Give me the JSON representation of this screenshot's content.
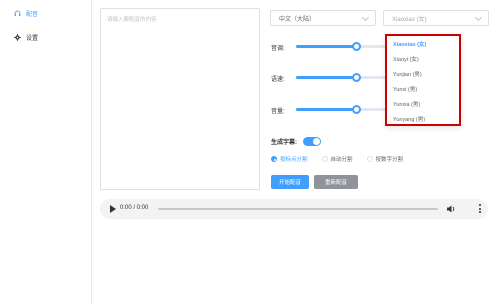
{
  "sidebar": {
    "items": [
      {
        "label": "配音",
        "icon": "headset-icon",
        "active": true
      },
      {
        "label": "设置",
        "icon": "gear-icon",
        "active": false
      }
    ]
  },
  "editor": {
    "placeholder": "请输入要配音的内容"
  },
  "language_select": {
    "value": "中文（大陆）"
  },
  "voice_select": {
    "value": "Xiaoxiao (女)"
  },
  "sliders": {
    "pitch": {
      "label": "音调:",
      "value": 0.5
    },
    "speed": {
      "label": "语速:",
      "value": 0.5
    },
    "volume": {
      "label": "音量:",
      "value": 0.5
    }
  },
  "subtitle": {
    "label": "生成字幕:",
    "enabled": true
  },
  "split_options": [
    {
      "label": "按标点分割",
      "checked": true
    },
    {
      "label": "自动分割",
      "checked": false
    },
    {
      "label": "按数字分割",
      "checked": false
    }
  ],
  "buttons": {
    "start": "开始配音",
    "refresh": "重新配音"
  },
  "audio": {
    "time": "0:00 / 0:00"
  },
  "voice_options": [
    "Xiaoxiao (女)",
    "Xiaoyi (女)",
    "Yunjian (男)",
    "Yunxi (男)",
    "Yunxia (男)",
    "Yunyang (男)"
  ],
  "colors": {
    "accent": "#409eff",
    "highlight": "#cc0000"
  }
}
